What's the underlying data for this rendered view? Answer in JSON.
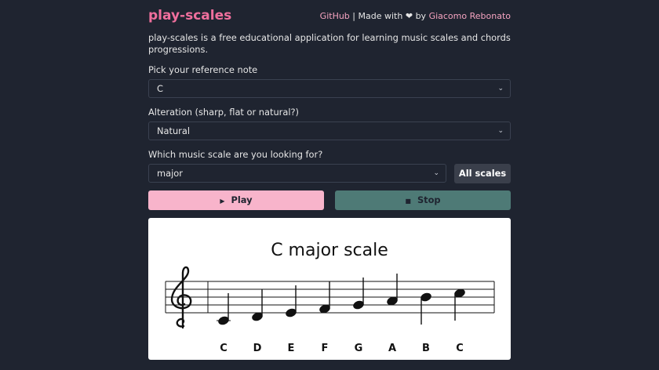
{
  "header": {
    "brand": "play-scales",
    "github": "GitHub",
    "separator": "|",
    "made_with": "Made with",
    "heart": "❤",
    "by": "by",
    "author": "Giacomo Rebonato"
  },
  "intro": "play-scales is a free educational application for learning music scales and chords progressions.",
  "form": {
    "note_label": "Pick your reference note",
    "note_value": "C",
    "alteration_label": "Alteration (sharp, flat or natural?)",
    "alteration_value": "Natural",
    "scale_label": "Which music scale are you looking for?",
    "scale_value": "major",
    "all_scales": "All scales"
  },
  "controls": {
    "play_icon": "▶",
    "play": "Play",
    "stop_icon": "■",
    "stop": "Stop"
  },
  "score": {
    "title": "C major scale",
    "clef": "treble-clef",
    "notes": [
      "C",
      "D",
      "E",
      "F",
      "G",
      "A",
      "B",
      "C"
    ]
  },
  "colors": {
    "background": "#1f2430",
    "brand": "#f06f9d",
    "play_button": "#f8b4cb",
    "stop_button": "#4e7a76",
    "all_scales_button": "#3a3f4b"
  }
}
